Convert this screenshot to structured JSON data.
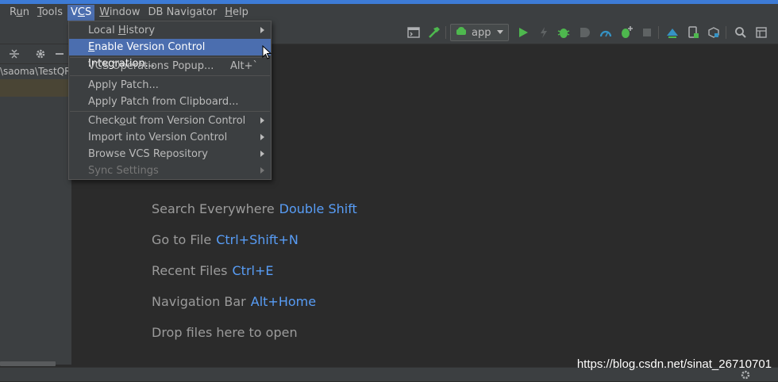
{
  "menubar": {
    "items": [
      {
        "label": "Run",
        "mnemonic_index": 1
      },
      {
        "label": "Tools",
        "mnemonic_index": 0
      },
      {
        "label": "VCS",
        "mnemonic_index": 1,
        "active": true
      },
      {
        "label": "Window",
        "mnemonic_index": 0
      },
      {
        "label": "DB Navigator",
        "mnemonic_index": -1
      },
      {
        "label": "Help",
        "mnemonic_index": 0
      }
    ]
  },
  "toolbar": {
    "run_config": "app",
    "icons": [
      "terminal-icon",
      "build-hammer-icon",
      "run-icon",
      "lightning-icon",
      "debug-bug-icon",
      "coverage-icon",
      "profiler-icon",
      "attach-debugger-icon",
      "stop-icon",
      "sync-icon",
      "device-icon",
      "sdk-icon",
      "search-icon",
      "layout-icon"
    ]
  },
  "left_panel": {
    "path_text": "\\saoma\\TestQR"
  },
  "vcs_menu": {
    "groups": [
      [
        {
          "label": "Local History",
          "pre": "Local ",
          "mn": "H",
          "post": "istory",
          "submenu": true
        },
        {
          "label": "Enable Version Control Integration...",
          "pre": "",
          "mn": "E",
          "post": "nable Version Control Integration...",
          "highlight": true
        }
      ],
      [
        {
          "label": "VCS Operations Popup...",
          "pre": "VCS Operations Popup...",
          "mn": "",
          "post": "",
          "shortcut": "Alt+`"
        }
      ],
      [
        {
          "label": "Apply Patch...",
          "pre": "Apply Patch...",
          "mn": "",
          "post": ""
        },
        {
          "label": "Apply Patch from Clipboard...",
          "pre": "Apply Patch from Clipboard...",
          "mn": "",
          "post": ""
        }
      ],
      [
        {
          "label": "Checkout from Version Control",
          "pre": "Check",
          "mn": "o",
          "post": "ut from Version Control",
          "submenu": true
        },
        {
          "label": "Import into Version Control",
          "pre": "Import into Version Control",
          "mn": "",
          "post": "",
          "submenu": true
        },
        {
          "label": "Browse VCS Repository",
          "pre": "Browse VCS Repository",
          "mn": "",
          "post": "",
          "submenu": true
        },
        {
          "label": "Sync Settings",
          "pre": "Sync Settings",
          "mn": "",
          "post": "",
          "submenu": true,
          "disabled": true
        }
      ]
    ]
  },
  "editor_hints": [
    {
      "text": "Search Everywhere",
      "key": "Double Shift"
    },
    {
      "text": "Go to File",
      "key": "Ctrl+Shift+N"
    },
    {
      "text": "Recent Files",
      "key": "Ctrl+E"
    },
    {
      "text": "Navigation Bar",
      "key": "Alt+Home"
    },
    {
      "text": "Drop files here to open",
      "key": ""
    }
  ],
  "watermark": "https://blog.csdn.net/sinat_26710701",
  "colors": {
    "accent": "#3d7bd6",
    "highlight": "#4b6eaf",
    "shortcut_blue": "#589df6",
    "run_green": "#4eb84e",
    "background": "#2b2b2b",
    "panel": "#3c3f41"
  }
}
